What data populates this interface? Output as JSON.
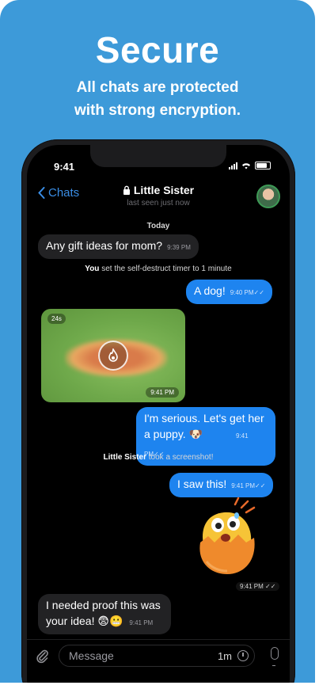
{
  "promo": {
    "headline": "Secure",
    "subline1": "All chats are protected",
    "subline2": "with strong encryption."
  },
  "status": {
    "time": "9:41"
  },
  "header": {
    "back_label": "Chats",
    "title": "Little Sister",
    "subtitle": "last seen just now",
    "lock_icon": "lock-icon"
  },
  "chat": {
    "day": "Today",
    "m1": {
      "text": "Any gift ideas for mom?",
      "time": "9:39 PM"
    },
    "sys1": {
      "bold": "You",
      "text": " set the self-destruct timer to 1 minute"
    },
    "m2": {
      "text": "A dog!",
      "time": "9:40 PM"
    },
    "photo": {
      "timer": "24s",
      "time": "9:41 PM",
      "icon": "flame-icon"
    },
    "m3": {
      "line1": "I'm serious. Let's get her",
      "line2": "a puppy. 🐶",
      "time": "9:41 PM"
    },
    "sys2": {
      "bold": "Little Sister",
      "text": " took a screenshot!"
    },
    "m4": {
      "text": "I saw this!",
      "time": "9:41 PM"
    },
    "sticker": {
      "time": "9:41 PM",
      "icon": "egg-sticker"
    },
    "m5": {
      "line1": "I needed proof this was",
      "line2": "your idea! 😨😬",
      "time": "9:41 PM"
    }
  },
  "composer": {
    "placeholder": "Message",
    "timer": "1m"
  },
  "colors": {
    "background": "#3d9ad9",
    "bubble_out": "#1e84ef",
    "bubble_in": "#222224"
  }
}
